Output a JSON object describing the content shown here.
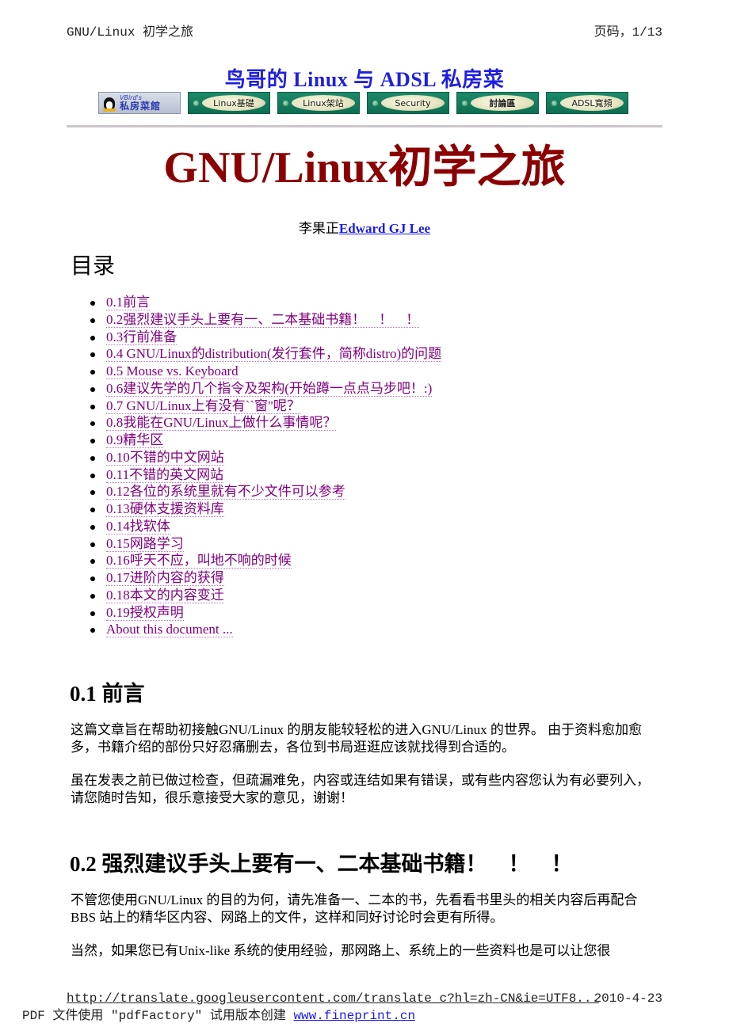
{
  "running_header": {
    "title": "GNU/Linux 初学之旅",
    "page": "页码，1/13"
  },
  "site_banner": "鸟哥的  Linux 与  ADSL 私房菜",
  "nav": {
    "logo_top": "VBird's",
    "logo_bottom": "私房菜館",
    "buttons": [
      {
        "label": "Linux基礎"
      },
      {
        "label": "Linux架站"
      },
      {
        "label": "Security"
      },
      {
        "label": "討論區"
      },
      {
        "label": "ADSL寬頻"
      }
    ]
  },
  "document": {
    "title": "GNU/Linux初学之旅",
    "author_cn": "李果正",
    "author_en": "Edward GJ Lee"
  },
  "toc": {
    "heading": "目录",
    "items": [
      "0.1前言",
      "0.2强烈建议手头上要有一、二本基础书籍！　！　！",
      "0.3行前准备",
      "0.4 GNU/Linux的distribution(发行套件，简称distro)的问题",
      "0.5 Mouse vs. Keyboard",
      "0.6建议先学的几个指令及架构(开始蹲一点点马步吧！:)",
      "0.7 GNU/Linux上有没有``窗\"呢？",
      "0.8我能在GNU/Linux上做什么事情呢？",
      "0.9精华区",
      "0.10不错的中文网站",
      "0.11不错的英文网站",
      "0.12各位的系统里就有不少文件可以参考",
      "0.13硬体支援资料库",
      "0.14找软体",
      "0.15网路学习",
      "0.16呼天不应，叫地不响的时候",
      "0.17进阶内容的获得",
      "0.18本文的内容变迁",
      "0.19授权声明",
      "About this document ..."
    ]
  },
  "sections": [
    {
      "heading": "0.1 前言",
      "paragraphs": [
        "这篇文章旨在帮助初接触GNU/Linux 的朋友能较轻松的进入GNU/Linux 的世界。 由于资料愈加愈多，书籍介绍的部份只好忍痛删去，各位到书局逛逛应该就找得到合适的。",
        "虽在发表之前已做过检查，但疏漏难免，内容或连结如果有错误，或有些内容您认为有必要列入，请您随时告知，很乐意接受大家的意见，谢谢！"
      ]
    },
    {
      "heading": "0.2 强烈建议手头上要有一、二本基础书籍！　！　！",
      "paragraphs": [
        "不管您使用GNU/Linux 的目的为何，请先准备一、二本的书，先看看书里头的相关内容后再配合BBS 站上的精华区内容、网路上的文件，这样和同好讨论时会更有所得。",
        "当然，如果您已有Unix-like 系统的使用经验，那网路上、系统上的一些资料也是可以让您很"
      ]
    }
  ],
  "page_footer": {
    "url": "http://translate.googleusercontent.com/translate_c?hl=zh-CN&ie=UTF8...",
    "date": "2010-4-23"
  },
  "pdf_footer": {
    "text": "PDF 文件使用 \"pdfFactory\" 试用版本创建 ",
    "link": "www.fineprint.cn"
  }
}
